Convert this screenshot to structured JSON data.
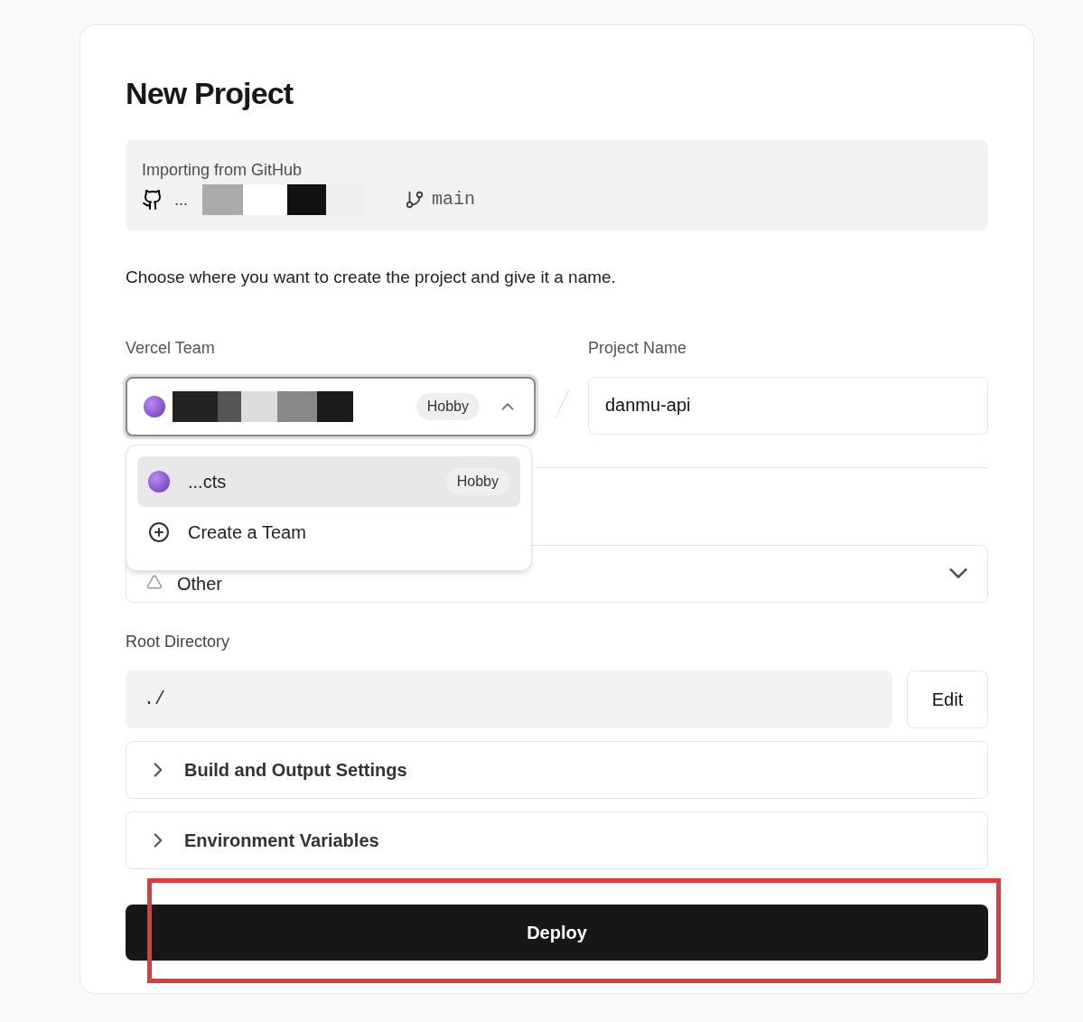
{
  "title": "New Project",
  "import": {
    "label": "Importing from GitHub",
    "repo": "...",
    "branch": "main"
  },
  "description": "Choose where you want to create the project and give it a name.",
  "team": {
    "label": "Vercel Team",
    "plan": "Hobby",
    "expanded": true
  },
  "team_menu": [
    {
      "kind": "team",
      "name": "...cts",
      "plan": "Hobby",
      "selected": true
    },
    {
      "kind": "create",
      "name": "Create a Team",
      "selected": false
    }
  ],
  "project_name": {
    "label": "Project Name",
    "value": "danmu-api"
  },
  "framework": {
    "value": "Other"
  },
  "root_directory": {
    "label": "Root Directory",
    "value": "./",
    "button": "Edit"
  },
  "sections": [
    {
      "label": "Build and Output Settings",
      "expanded": false
    },
    {
      "label": "Environment Variables",
      "expanded": false
    }
  ],
  "deploy": {
    "label": "Deploy",
    "highlighted": true
  }
}
